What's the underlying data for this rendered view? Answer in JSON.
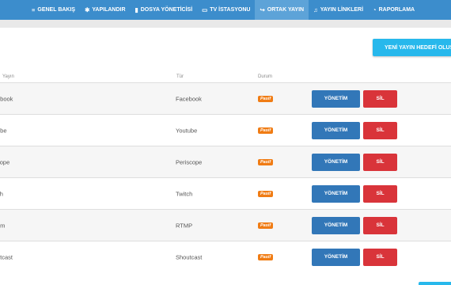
{
  "nav": {
    "items": [
      {
        "icon": "≡",
        "label": "GENEL BAKIŞ"
      },
      {
        "icon": "✱",
        "label": "YAPILANDIR"
      },
      {
        "icon": "▮",
        "label": "DOSYA YÖNETİCİSİ"
      },
      {
        "icon": "▭",
        "label": "TV İSTASYONU"
      },
      {
        "icon": "↪",
        "label": "ORTAK YAYIN"
      },
      {
        "icon": "♫",
        "label": "YAYIN LİNKLERİ"
      },
      {
        "icon": "◔",
        "label": "RAPORLAMA"
      }
    ],
    "active_index": 4
  },
  "actions": {
    "add_target_label": "YENİ YAYIN HEDEFİ OLUŞTU"
  },
  "table": {
    "headers": [
      "Yayın",
      "Tür",
      "Durum"
    ],
    "rows": [
      {
        "name": "ebook",
        "type": "Facebook",
        "status": "Pasif"
      },
      {
        "name": "ube",
        "type": "Youtube",
        "status": "Pasif"
      },
      {
        "name": "cope",
        "type": "Periscope",
        "status": "Pasif"
      },
      {
        "name": "ch",
        "type": "Twitch",
        "status": "Pasif"
      },
      {
        "name": "om",
        "type": "RTMP",
        "status": "Pasif"
      },
      {
        "name": "htcast",
        "type": "Shoutcast",
        "status": "Pasif"
      }
    ],
    "manage_label": "YÖNETİM",
    "delete_label": "SİL"
  },
  "colors": {
    "navbar": "#3c8dcc",
    "accent": "#27b8ec",
    "manage": "#3277b8",
    "delete": "#d9343a",
    "status_inactive": "#f07c14"
  },
  "icons": {
    "nav": [
      "menu-icon",
      "wrench-icon",
      "file-icon",
      "monitor-icon",
      "share-icon",
      "music-icon",
      "pie-chart-icon"
    ]
  }
}
